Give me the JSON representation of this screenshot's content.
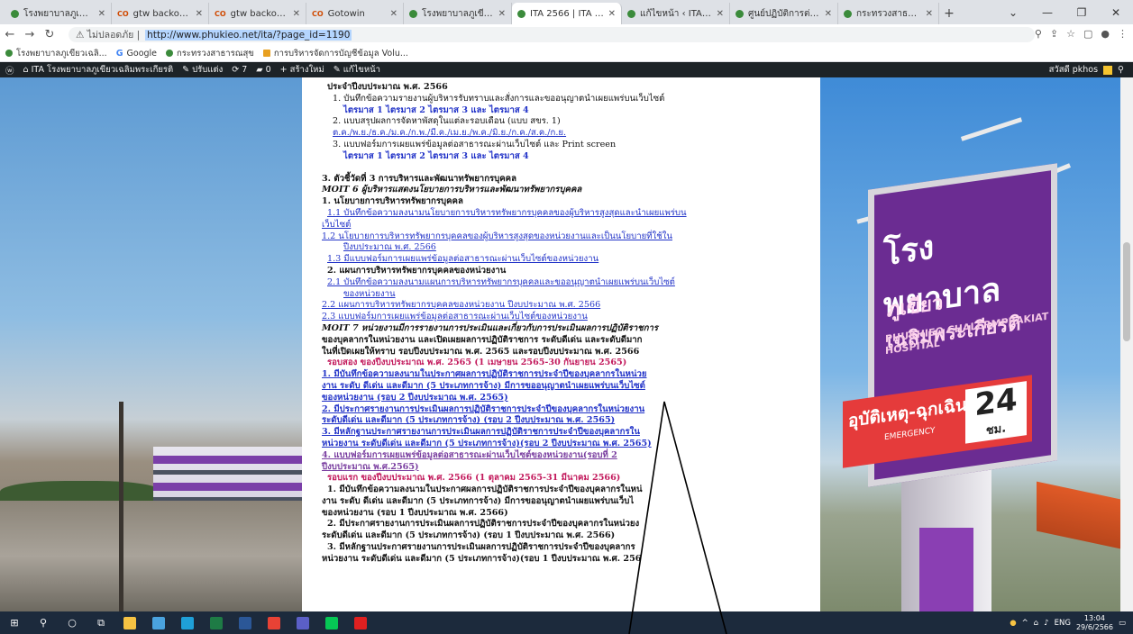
{
  "browser": {
    "tabs": [
      {
        "label": "โรงพยาบาลภูเขียวเฉลิมพ...",
        "icon": "green-circle-icon"
      },
      {
        "label": "gtw backoffice",
        "icon": "co-icon"
      },
      {
        "label": "gtw backoffice",
        "icon": "co-icon"
      },
      {
        "label": "Gotowin",
        "icon": "co-icon"
      },
      {
        "label": "โรงพยาบาลภูเขียวเฉลิมพ...",
        "icon": "green-circle-icon"
      },
      {
        "label": "ITA 2566 | ITA โรงพยาบ...",
        "icon": "green-circle-icon"
      },
      {
        "label": "แก้ไขหน้า ‹ ITA โรงพยาบ...",
        "icon": "green-circle-icon"
      },
      {
        "label": "ศูนย์ปฏิบัติการต่อต้านการ...",
        "icon": "green-circle-icon"
      },
      {
        "label": "กระทรวงสาธารณสุข",
        "icon": "green-circle-icon"
      }
    ],
    "active_tab_index": 5,
    "new_tab": "+",
    "window_controls": {
      "minimize": "—",
      "restore": "❐",
      "close": "✕",
      "dropdown": "⌄"
    },
    "secure_label": "ไม่ปลอดภัย",
    "url": "http://www.phukieo.net/ita/?page_id=1190",
    "bookmarks": [
      {
        "label": "โรงพยาบาลภูเขียวเฉลิ..."
      },
      {
        "label": "Google"
      },
      {
        "label": "กระทรวงสาธารณสุข"
      },
      {
        "label": "การบริหารจัดการบัญชีข้อมูล Volu..."
      }
    ]
  },
  "wp_admin_bar": {
    "site_name": "ITA โรงพยาบาลภูเขียวเฉลิมพระเกียรติ",
    "customize": "ปรับแต่ง",
    "updates": "7",
    "comments": "0",
    "new": "สร้างใหม่",
    "edit": "แก้ไขหน้า",
    "greeting": "สวัสดี pkhos"
  },
  "page": {
    "lines": [
      {
        "text": "ประจำปีงบประมาณ พ.ศ. 2566",
        "cls": "b in1"
      },
      {
        "text": "1. บันทึกข้อความรายงานผู้บริหารรับทราบและสั่งการและขออนุญาตนำเผยแพร่บนเว็บไซต์",
        "cls": "in2"
      },
      {
        "text": "ไตรมาส 1 ไตรมาส 2 ไตรมาส 3 และ ไตรมาส 4",
        "cls": "in3 b",
        "linky": true
      },
      {
        "text": "2. แบบสรุปผลการจัดหาพัสดุในแต่ละรอบเดือน (แบบ สขร. 1)",
        "cls": "in2"
      },
      {
        "text": "ต.ค./พ.ย./ธ.ค./ม.ค./ก.พ./มี.ค./เม.ย./พ.ค./มิ.ย./ก.ค./ส.ค./ก.ย.",
        "cls": "in2 lnk"
      },
      {
        "text": "3. แบบฟอร์มการเผยแพร่ข้อมูลต่อสาธารณะผ่านเว็บไซต์ และ Print screen",
        "cls": "in2"
      },
      {
        "text": "ไตรมาส 1 ไตรมาส 2 ไตรมาส 3 และ ไตรมาส 4",
        "cls": "in3 b",
        "linky": true
      },
      {
        "text": "",
        "cls": "gap"
      },
      {
        "text": "3. ตัวชี้วัดที่ 3 การบริหารและพัฒนาทรัพยากรบุคคล",
        "cls": "b"
      },
      {
        "text": "MOIT 6 ผู้บริหารแสดงนโยบายการบริหารและพัฒนาทรัพยากรบุคคล",
        "cls": "b it"
      },
      {
        "text": "1. นโยบายการบริหารทรัพยากรบุคคล",
        "cls": "b"
      },
      {
        "text": "1.1 บันทึกข้อความลงนามนโยบายการบริหารทรัพยากรบุคคลของผู้บริหารสูงสุดและนำเผยแพร่บน",
        "cls": "in1 lnk"
      },
      {
        "text": "เว็บไซต์",
        "cls": "lnk"
      },
      {
        "text": "1.2 นโยบายการบริหารทรัพยากรบุคคลของผู้บริหารสูงสุดของหน่วยงานและเป็นนโยบายที่ใช้ใน",
        "cls": "lnk"
      },
      {
        "text": "ปีงบประมาณ พ.ศ. 2566",
        "cls": "in3 lnk"
      },
      {
        "text": "1.3 มีแบบฟอร์มการเผยแพร่ข้อมูลต่อสาธารณะผ่านเว็บไซต์ของหน่วยงาน",
        "cls": "in1 lnk"
      },
      {
        "text": "2. แผนการบริหารทรัพยากรบุคคลของหน่วยงาน",
        "cls": "in1 b"
      },
      {
        "text": "2.1 บันทึกข้อความลงนามแผนการบริหารทรัพยากรบุคคลและขออนุญาตนำเผยแพร่บนเว็บไซต์",
        "cls": "in1 lnk"
      },
      {
        "text": "ของหน่วยงาน",
        "cls": "in3 lnk"
      },
      {
        "text": "2.2 แผนการบริหารทรัพยากรบุคคลของหน่วยงาน ปีงบประมาณ พ.ศ. 2566",
        "cls": "lnk"
      },
      {
        "text": "2.3 แบบฟอร์มการเผยแพร่ข้อมูลต่อสาธารณะผ่านเว็บไซต์ของหน่วยงาน",
        "cls": "lnk"
      },
      {
        "text": "MOIT 7 หน่วยงานมีการรายงานการประเมินและเกี่ยวกับการประเมินผลการปฏิบัติราชการ",
        "cls": "b it"
      },
      {
        "text": "ของบุคลากรในหน่วยงาน และเปิดเผยผลการปฏิบัติราชการ ระดับดีเด่น และระดับดีมาก",
        "cls": "b"
      },
      {
        "text": "ในที่เปิดเผยให้ทราบ รอบปีงบประมาณ พ.ศ. 2565 และรอบปีงบประมาณ พ.ศ. 2566",
        "cls": "b"
      },
      {
        "text": "รอบสอง ของปีงบประมาณ พ.ศ. 2565 (1 เมษายน 2565-30 กันยายน 2565)",
        "cls": "in1 b red"
      },
      {
        "text": "1. มีบันทึกข้อความลงนามในประกาศผลการปฏิบัติราชการประจำปีของบุคลากรในหน่วย",
        "cls": "b lnk"
      },
      {
        "text": "งาน ระดับ   ดีเด่น และดีมาก (5 ประเภทการจ้าง) มีการขออนุญาตนำเผยแพร่บนเว็บไซต์",
        "cls": "b lnk"
      },
      {
        "text": "ของหน่วยงาน (รอบ 2 ปีงบประมาณ พ.ศ. 2565)",
        "cls": "b lnk"
      },
      {
        "text": "2. มีประกาศรายงานการประเมินผลการปฏิบัติราชการประจำปีของบุคลากรในหน่วยงาน",
        "cls": "b lnk"
      },
      {
        "text": "ระดับดีเด่น และดีมาก (5 ประเภทการจ้าง) (รอบ 2 ปีงบประมาณ พ.ศ. 2565)",
        "cls": "b lnk"
      },
      {
        "text": "3. มีหลักฐานประกาศรายงานการประเมินผลการปฏิบัติราชการประจำปีของบุคลากรใน",
        "cls": "b lnk"
      },
      {
        "text": "หน่วยงาน ระดับดีเด่น และดีมาก (5 ประเภทการจ้าง)(รอบ 2 ปีงบประมาณ พ.ศ. 2565)",
        "cls": "b lnk"
      },
      {
        "text": "4. แบบฟอร์มการเผยแพร่ข้อมูลต่อสาธารณะผ่านเว็บไซต์ของหน่วยงาน(รอบที่ 2",
        "cls": "b vlnk"
      },
      {
        "text": "ปีงบประมาณ พ.ศ.2565)",
        "cls": "b vlnk"
      },
      {
        "text": "รอบแรก ของปีงบประมาณ พ.ศ. 2566 (1 ตุลาคม 2565-31 มีนาคม 2566)",
        "cls": "in1 b red"
      },
      {
        "text": "1. มีบันทึกข้อความลงนามในประกาศผลการปฏิบัติราชการประจำปีของบุคลากรในหน่",
        "cls": "in1 b"
      },
      {
        "text": "งาน ระดับ   ดีเด่น และดีมาก (5 ประเภทการจ้าง) มีการขออนุญาตนำเผยแพร่บนเว็บไ",
        "cls": "b"
      },
      {
        "text": "ของหน่วยงาน (รอบ 1 ปีงบประมาณ พ.ศ. 2566)",
        "cls": "b"
      },
      {
        "text": "2. มีประกาศรายงานการประเมินผลการปฏิบัติราชการประจำปีของบุคลากรในหน่วยง",
        "cls": "in1 b"
      },
      {
        "text": "ระดับดีเด่น และดีมาก (5 ประเภทการจ้าง) (รอบ 1 ปีงบประมาณ พ.ศ. 2566)",
        "cls": "b"
      },
      {
        "text": "3. มีหลักฐานประกาศรายงานการประเมินผลการปฏิบัติราชการประจำปีของบุคลากร",
        "cls": "in1 b"
      },
      {
        "text": "หน่วยงาน ระดับดีเด่น และดีมาก (5 ประเภทการจ้าง)(รอบ 1 ปีงบประมาณ พ.ศ. 256",
        "cls": "b"
      }
    ]
  },
  "background": {
    "hospital_sign_th1": "โรงพยาบาล",
    "hospital_sign_th2": "ภูเขียวเฉลิมพระเกียรติ",
    "hospital_sign_en": "PHUKHIEO CHALERMPRAKIAT HOSPITAL",
    "emergency_th": "อุบัติเหตุ-ฉุกเฉิน",
    "emergency_en": "EMERGENCY",
    "hours_number": "24",
    "hours_unit": "ชม."
  },
  "taskbar": {
    "icons": [
      "windows-start-icon",
      "search-icon",
      "cortana-icon",
      "task-view-icon",
      "file-explorer-icon",
      "paint-icon",
      "edge-icon",
      "excel-icon",
      "word-icon",
      "chrome-icon",
      "teams-icon",
      "line-icon",
      "acrobat-icon"
    ],
    "tray_lang": "ENG",
    "time": "13:04",
    "date": "29/6/2566"
  },
  "colors": {
    "link": "#2233c8",
    "visited": "#7a3fa0",
    "heading_red": "#c2185b",
    "wpbar": "#1d2327",
    "taskbar": "#1c2a3c"
  }
}
